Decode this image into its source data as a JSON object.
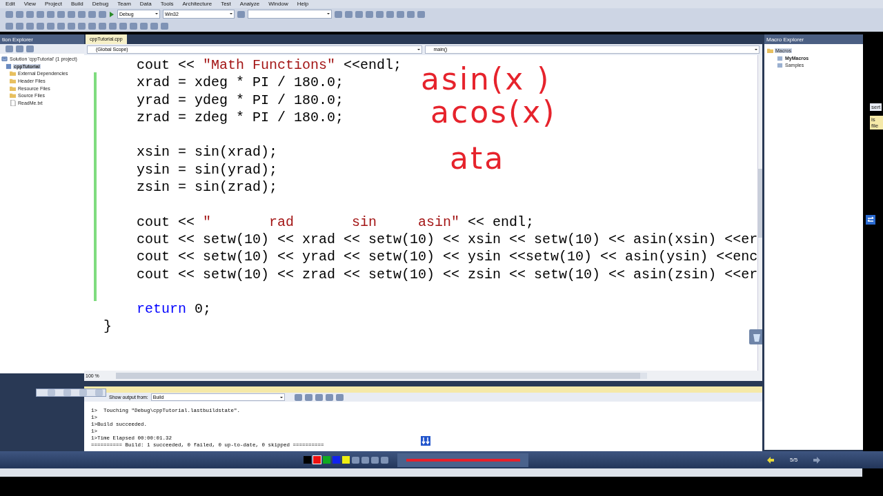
{
  "menu": [
    "Edit",
    "View",
    "Project",
    "Build",
    "Debug",
    "Team",
    "Data",
    "Tools",
    "Architecture",
    "Test",
    "Analyze",
    "Window",
    "Help"
  ],
  "toolbar": {
    "configuration": "Debug",
    "platform": "Win32"
  },
  "solution_explorer": {
    "title": "tion Explorer",
    "items": [
      {
        "label": "Solution 'cppTutorial' (1 project)",
        "kind": "solution",
        "selected": false,
        "bold": false,
        "children": [
          {
            "label": "cppTutorial",
            "kind": "project",
            "selected": true,
            "bold": true,
            "children": [
              {
                "label": "External Dependencies",
                "kind": "folder",
                "selected": false,
                "bold": false
              },
              {
                "label": "Header Files",
                "kind": "folder",
                "selected": false,
                "bold": false
              },
              {
                "label": "Resource Files",
                "kind": "folder",
                "selected": false,
                "bold": false
              },
              {
                "label": "Source Files",
                "kind": "folder",
                "selected": false,
                "bold": false
              },
              {
                "label": "ReadMe.txt",
                "kind": "file",
                "selected": false,
                "bold": false
              }
            ]
          }
        ]
      }
    ]
  },
  "editor": {
    "tab": "cppTutorial.cpp",
    "scope": "(Global Scope)",
    "member": "main()",
    "zoom": "100 %",
    "code_blocks": [
      [
        {
          "indent": true,
          "tokens": [
            {
              "t": "cout << ",
              "kind": "plain"
            },
            {
              "t": "\"Math Functions\"",
              "kind": "string"
            },
            {
              "t": " <<endl;",
              "kind": "plain"
            }
          ]
        },
        {
          "indent": true,
          "tokens": [
            {
              "t": "xrad = xdeg * PI / 180.0;",
              "kind": "plain"
            }
          ]
        },
        {
          "indent": true,
          "tokens": [
            {
              "t": "yrad = ydeg * PI / 180.0;",
              "kind": "plain"
            }
          ]
        },
        {
          "indent": true,
          "tokens": [
            {
              "t": "zrad = zdeg * PI / 180.0;",
              "kind": "plain"
            }
          ]
        }
      ],
      [
        {
          "indent": true,
          "tokens": [
            {
              "t": "xsin = sin(xrad);",
              "kind": "plain"
            }
          ]
        },
        {
          "indent": true,
          "tokens": [
            {
              "t": "ysin = sin(yrad);",
              "kind": "plain"
            }
          ]
        },
        {
          "indent": true,
          "tokens": [
            {
              "t": "zsin = sin(zrad);",
              "kind": "plain"
            }
          ]
        }
      ],
      [
        {
          "indent": true,
          "tokens": [
            {
              "t": "cout << ",
              "kind": "plain"
            },
            {
              "t": "\"       rad       sin     asin\"",
              "kind": "string"
            },
            {
              "t": " << endl;",
              "kind": "plain"
            }
          ]
        },
        {
          "indent": true,
          "tokens": [
            {
              "t": "cout << setw(10) << xrad << setw(10) << xsin << setw(10) << asin(xsin) <<er",
              "kind": "plain"
            }
          ]
        },
        {
          "indent": true,
          "tokens": [
            {
              "t": "cout << setw(10) << yrad << setw(10) << ysin <<setw(10) << asin(ysin) <<enc",
              "kind": "plain"
            }
          ]
        },
        {
          "indent": true,
          "tokens": [
            {
              "t": "cout << setw(10) << zrad << setw(10) << zsin << setw(10) << asin(zsin) <<er",
              "kind": "plain"
            }
          ]
        }
      ],
      [
        {
          "indent": true,
          "tokens": [
            {
              "t": "return",
              "kind": "keyword"
            },
            {
              "t": " 0;",
              "kind": "plain"
            }
          ]
        },
        {
          "indent": false,
          "tokens": [
            {
              "t": "}",
              "kind": "plain"
            }
          ]
        }
      ]
    ]
  },
  "annotations": [
    "asin(x )",
    "acos(x)",
    "ata"
  ],
  "output": {
    "show_from_label": "Show output from:",
    "source": "Build",
    "lines": [
      "1>  Touching \"Debug\\cppTutorial.lastbuildstate\".",
      "1>",
      "1>Build succeeded.",
      "1>",
      "1>Time Elapsed 00:00:01.32",
      "========== Build: 1 succeeded, 0 failed, 0 up-to-date, 0 skipped =========="
    ]
  },
  "macro_explorer": {
    "title": "Macro Explorer",
    "items": [
      {
        "label": "Macros",
        "kind": "root",
        "selected": true,
        "bold": false,
        "children": [
          {
            "label": "MyMacros",
            "kind": "project",
            "selected": false,
            "bold": true
          },
          {
            "label": "Samples",
            "kind": "project",
            "selected": false,
            "bold": false
          }
        ]
      }
    ]
  },
  "right_edge_fragments": [
    "sert",
    "is file"
  ],
  "bottom_bar": {
    "colors": [
      {
        "color": "#000000",
        "selected": false
      },
      {
        "color": "#ee1111",
        "selected": true
      },
      {
        "color": "#11aa22",
        "selected": false
      },
      {
        "color": "#1122ee",
        "selected": false
      },
      {
        "color": "#eeee11",
        "selected": false
      }
    ],
    "page": "5/5"
  }
}
